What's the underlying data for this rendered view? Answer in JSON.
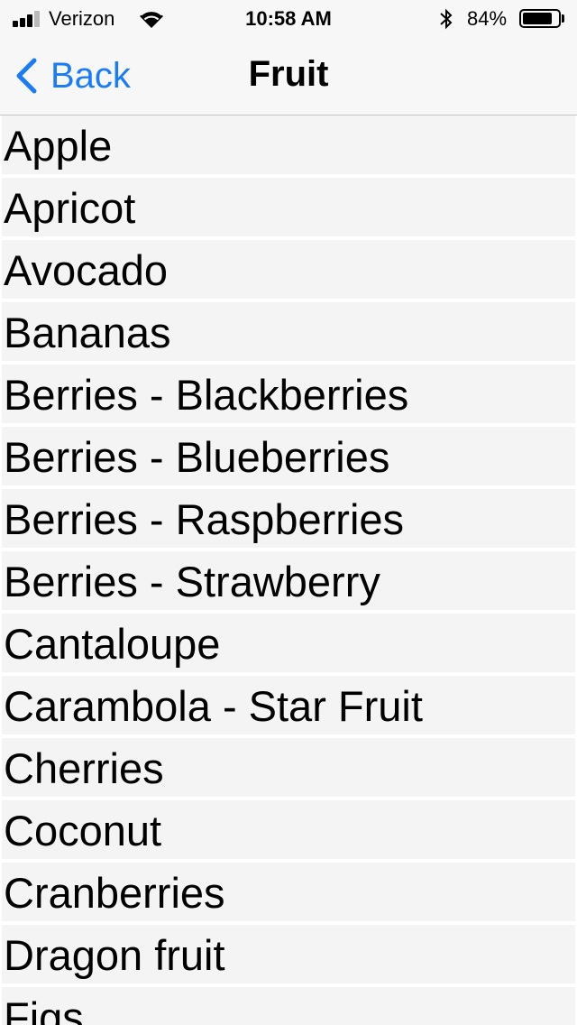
{
  "status_bar": {
    "carrier": "Verizon",
    "time": "10:58 AM",
    "battery_percent": "84%",
    "battery_level": 0.84,
    "signal_bars": 3,
    "signal_total": 4,
    "icons": [
      "signal-icon",
      "wifi-icon",
      "bluetooth-icon",
      "battery-icon"
    ]
  },
  "nav": {
    "back_label": "Back",
    "title": "Fruit",
    "accent_color": "#1a7cf6"
  },
  "list": {
    "items": [
      "Apple",
      "Apricot",
      "Avocado",
      "Bananas",
      "Berries - Blackberries",
      "Berries - Blueberries",
      "Berries - Raspberries",
      "Berries - Strawberry",
      "Cantaloupe",
      "Carambola - Star Fruit",
      "Cherries",
      "Coconut",
      "Cranberries",
      "Dragon fruit",
      "Figs"
    ]
  }
}
